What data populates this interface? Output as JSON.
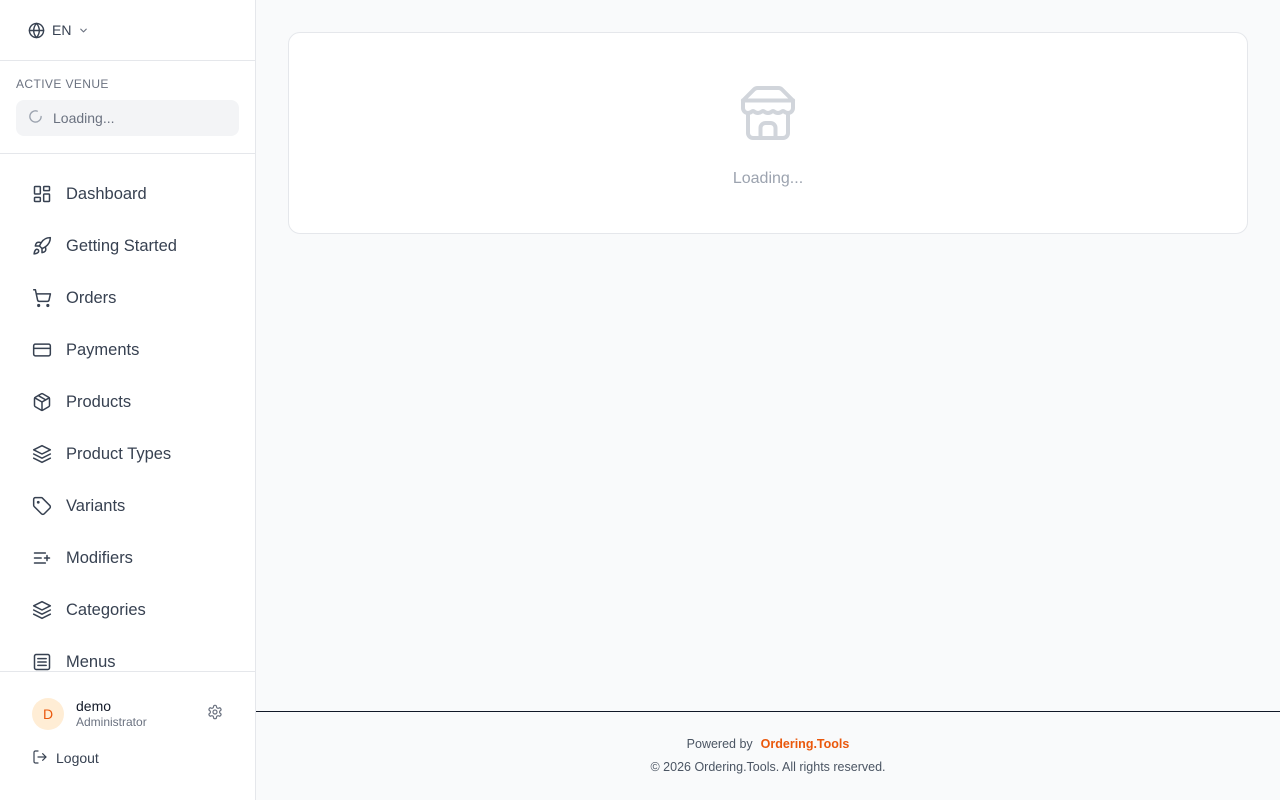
{
  "theme": {
    "accent": "#ea580c",
    "avatar_bg": "#ffedd5"
  },
  "language": {
    "current": "EN",
    "icon": "globe-icon"
  },
  "venue": {
    "label": "ACTIVE VENUE",
    "value": "Loading..."
  },
  "nav": {
    "items": [
      {
        "label": "Dashboard",
        "icon": "dashboard-icon"
      },
      {
        "label": "Getting Started",
        "icon": "rocket-icon"
      },
      {
        "label": "Orders",
        "icon": "cart-icon"
      },
      {
        "label": "Payments",
        "icon": "credit-card-icon"
      },
      {
        "label": "Products",
        "icon": "package-icon"
      },
      {
        "label": "Product Types",
        "icon": "layers-icon"
      },
      {
        "label": "Variants",
        "icon": "tag-icon"
      },
      {
        "label": "Modifiers",
        "icon": "list-plus-icon"
      },
      {
        "label": "Categories",
        "icon": "layers-icon"
      },
      {
        "label": "Menus",
        "icon": "menu-doc-icon"
      }
    ]
  },
  "user": {
    "initial": "D",
    "name": "demo",
    "role": "Administrator"
  },
  "logout": {
    "label": "Logout"
  },
  "main": {
    "loading_text": "Loading...",
    "icon": "store-icon"
  },
  "footer": {
    "powered_by": "Powered by",
    "brand": "Ordering.Tools",
    "copyright": "© 2026 Ordering.Tools. All rights reserved."
  }
}
